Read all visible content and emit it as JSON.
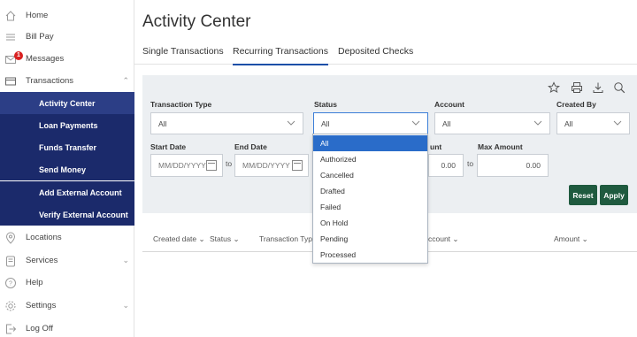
{
  "sidebar": {
    "items": [
      {
        "label": "Home",
        "icon": "home-icon"
      },
      {
        "label": "Bill Pay",
        "icon": "menu-icon"
      },
      {
        "label": "Messages",
        "icon": "mail-icon",
        "badge": "1"
      },
      {
        "label": "Transactions",
        "icon": "card-icon"
      },
      {
        "label": "Locations",
        "icon": "location-pin-icon"
      },
      {
        "label": "Services",
        "icon": "clipboard-icon"
      },
      {
        "label": "Help",
        "icon": "help-icon"
      },
      {
        "label": "Settings",
        "icon": "gear-icon"
      },
      {
        "label": "Log Off",
        "icon": "logoff-icon"
      }
    ],
    "sub_items": [
      {
        "label": "Activity Center",
        "active": true
      },
      {
        "label": "Loan Payments"
      },
      {
        "label": "Funds Transfer"
      },
      {
        "label": "Send Money"
      },
      {
        "label": "Add External Account"
      },
      {
        "label": "Verify External Account"
      }
    ]
  },
  "header": {
    "title": "Activity Center"
  },
  "tabs": [
    {
      "label": "Single Transactions"
    },
    {
      "label": "Recurring Transactions",
      "active": true
    },
    {
      "label": "Deposited Checks"
    }
  ],
  "filters": {
    "transaction_type": {
      "label": "Transaction Type",
      "value": "All"
    },
    "status": {
      "label": "Status",
      "value": "All"
    },
    "account": {
      "label": "Account",
      "value": "All"
    },
    "created_by": {
      "label": "Created By",
      "value": "All"
    },
    "start_date": {
      "label": "Start Date",
      "placeholder": "MM/DD/YYYY"
    },
    "end_date": {
      "label": "End Date",
      "placeholder": "MM/DD/YYYY"
    },
    "min_amount": {
      "label_partial": "unt",
      "value": "0.00"
    },
    "max_amount": {
      "label": "Max Amount",
      "value": "0.00"
    },
    "to_label": "to",
    "reset_label": "Reset",
    "apply_label": "Apply"
  },
  "status_options": [
    "All",
    "Authorized",
    "Cancelled",
    "Drafted",
    "Failed",
    "On Hold",
    "Pending",
    "Processed"
  ],
  "columns": {
    "created_date": "Created date",
    "status": "Status",
    "transaction_type": "Transaction Type",
    "account": "ccount",
    "amount": "Amount"
  },
  "colors": {
    "nav_bg": "#1b2a6b",
    "accent": "#1b4fa8",
    "button": "#1f5a3f",
    "selected_option": "#2a6cc9"
  }
}
